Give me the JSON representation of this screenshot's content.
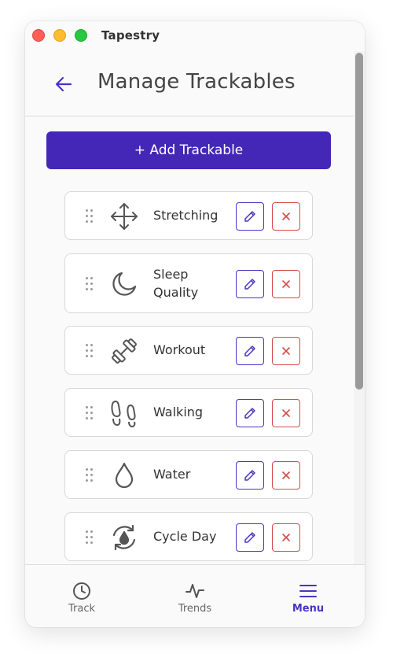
{
  "window": {
    "title": "Tapestry"
  },
  "header": {
    "title": "Manage Trackables",
    "back_icon": "arrow-left-icon"
  },
  "add_button": {
    "label": "+ Add Trackable"
  },
  "trackables": [
    {
      "label": "Stretching",
      "icon": "move-arrows-icon"
    },
    {
      "label": "Sleep Quality",
      "icon": "moon-icon"
    },
    {
      "label": "Workout",
      "icon": "dumbbell-icon"
    },
    {
      "label": "Walking",
      "icon": "footprints-icon"
    },
    {
      "label": "Water",
      "icon": "droplet-icon"
    },
    {
      "label": "Cycle Day",
      "icon": "cycle-icon"
    }
  ],
  "bottom_nav": [
    {
      "label": "Track",
      "icon": "clock-icon",
      "active": false
    },
    {
      "label": "Trends",
      "icon": "activity-icon",
      "active": false
    },
    {
      "label": "Menu",
      "icon": "menu-icon",
      "active": true
    }
  ],
  "colors": {
    "accent": "#4527b8",
    "danger": "#d44a4a",
    "text": "#333333"
  }
}
